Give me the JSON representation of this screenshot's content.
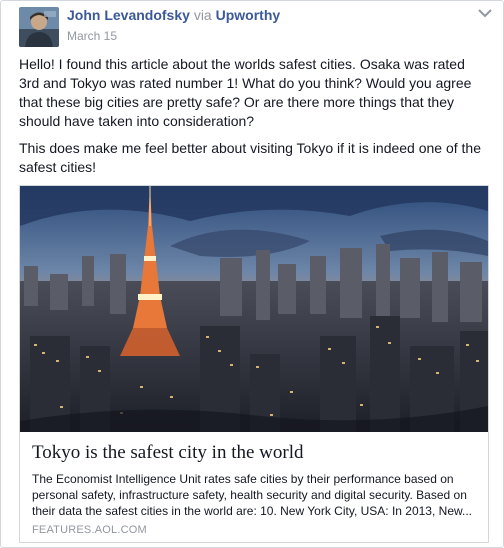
{
  "post": {
    "author_name": "John Levandofsky",
    "via_text": "via",
    "page_name": "Upworthy",
    "date": "March 15",
    "icons": {
      "avatar": "user-avatar",
      "menu": "chevron-down-icon"
    },
    "paragraphs": [
      "Hello! I found this article about the worlds safest cities. Osaka was rated 3rd and Tokyo was rated number 1! What do you think? Would you agree that these big cities are pretty safe? Or are there more things that they should have taken into consideration?",
      "This does make me feel better about visiting Tokyo if it is indeed one of the safest cities!"
    ]
  },
  "link": {
    "title": "Tokyo is the safest city in the world",
    "description": "The Economist Intelligence Unit rates safe cities by their performance based on personal safety, infrastructure safety, health security and digital security. Based on their data the safest cities in the world are: 10. New York City, USA: In 2013, New...",
    "domain": "FEATURES.AOL.COM",
    "image": "tokyo-skyline-at-dusk-with-tokyo-tower"
  },
  "colors": {
    "link_blue": "#3b5998",
    "meta_gray": "#9197a3",
    "border": "#d3d6db"
  }
}
